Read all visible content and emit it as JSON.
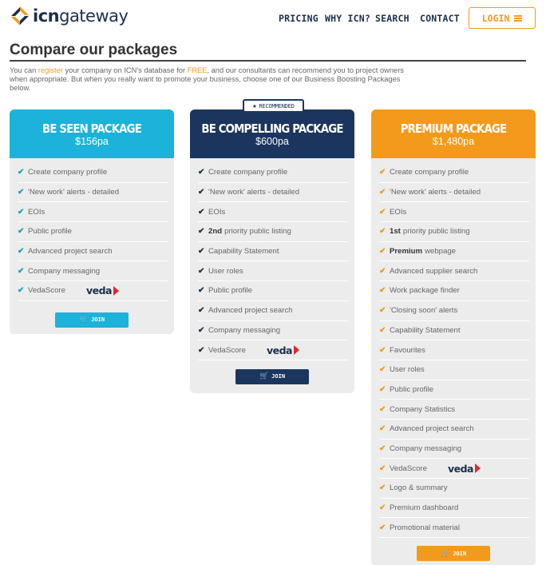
{
  "header": {
    "logo_text_bold": "icn",
    "logo_text_rest": "gateway",
    "nav": [
      "PRICING",
      "WHY ICN?",
      "SEARCH",
      "CONTACT"
    ],
    "login_label": "LOGIN",
    "colors": {
      "brand_navy": "#1b2f4d",
      "brand_orange": "#f39a1d"
    }
  },
  "page": {
    "title": "Compare our packages",
    "intro_1": "You can ",
    "intro_link_register": "register",
    "intro_2": " your company on ICN's database for ",
    "intro_free": "FREE",
    "intro_3": ", and our consultants can recommend you to project owners when appropriate. But when you really want to promote your business, choose one of our Business Boosting Packages below."
  },
  "badge": {
    "label": "RECOMMENDED",
    "icon": "star-icon"
  },
  "packages": [
    {
      "name": "BE SEEN PACKAGE",
      "price": "$156pa",
      "color": "#1cb2d9",
      "features": [
        {
          "bold": "",
          "text": "Create company profile"
        },
        {
          "bold": "",
          "text": "'New work' alerts - detailed"
        },
        {
          "bold": "",
          "text": "EOIs"
        },
        {
          "bold": "",
          "text": "Public profile"
        },
        {
          "bold": "",
          "text": "Advanced project search"
        },
        {
          "bold": "",
          "text": "Company messaging"
        },
        {
          "bold": "",
          "text": "VedaScore",
          "logo": "veda"
        }
      ],
      "join_label": "JOIN"
    },
    {
      "name": "BE COMPELLING PACKAGE",
      "price": "$600pa",
      "color": "#1b355e",
      "features": [
        {
          "bold": "",
          "text": "Create company profile"
        },
        {
          "bold": "",
          "text": "'New work' alerts - detailed"
        },
        {
          "bold": "",
          "text": "EOIs"
        },
        {
          "bold": "2nd",
          "text": "priority public listing"
        },
        {
          "bold": "",
          "text": "Capability Statement"
        },
        {
          "bold": "",
          "text": "User roles"
        },
        {
          "bold": "",
          "text": "Public profile"
        },
        {
          "bold": "",
          "text": "Advanced project search"
        },
        {
          "bold": "",
          "text": "Company messaging"
        },
        {
          "bold": "",
          "text": "VedaScore",
          "logo": "veda"
        }
      ],
      "join_label": "JOIN"
    },
    {
      "name": "PREMIUM PACKAGE",
      "price": "$1,480pa",
      "color": "#f39a1d",
      "features": [
        {
          "bold": "",
          "text": "Create company profile"
        },
        {
          "bold": "",
          "text": "'New work' alerts - detailed"
        },
        {
          "bold": "",
          "text": "EOIs"
        },
        {
          "bold": "1st",
          "text": "priority public listing"
        },
        {
          "bold": "Premium",
          "text": "webpage"
        },
        {
          "bold": "",
          "text": "Advanced supplier search"
        },
        {
          "bold": "",
          "text": "Work package finder"
        },
        {
          "bold": "",
          "text": "'Closing soon' alerts"
        },
        {
          "bold": "",
          "text": "Capability Statement"
        },
        {
          "bold": "",
          "text": "Favourites"
        },
        {
          "bold": "",
          "text": "User roles"
        },
        {
          "bold": "",
          "text": "Public profile"
        },
        {
          "bold": "",
          "text": "Company Statistics"
        },
        {
          "bold": "",
          "text": "Advanced project search"
        },
        {
          "bold": "",
          "text": "Company messaging"
        },
        {
          "bold": "",
          "text": "VedaScore",
          "logo": "veda"
        },
        {
          "bold": "",
          "text": "Logo & summary"
        },
        {
          "bold": "",
          "text": "Premium dashboard"
        },
        {
          "bold": "",
          "text": "Promotional material"
        }
      ],
      "join_label": "JOIN"
    }
  ],
  "veda_logo_text": "veda"
}
